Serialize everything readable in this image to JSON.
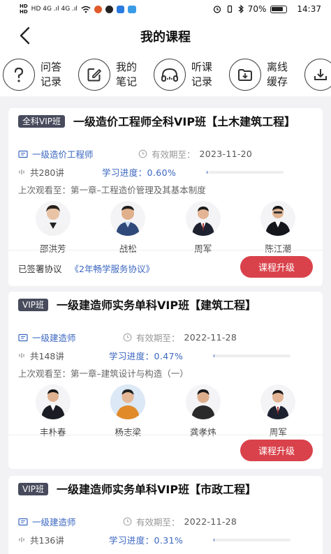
{
  "status_bar": {
    "carrier_left": "HD 4G .ıl 4G .ıl",
    "battery_pct": "70%",
    "time": "14:37"
  },
  "header": {
    "title": "我的课程"
  },
  "tools": [
    {
      "label": "问答\n记录",
      "icon": "question-icon"
    },
    {
      "label": "我的\n笔记",
      "icon": "note-icon"
    },
    {
      "label": "听课\n记录",
      "icon": "headphones-icon"
    },
    {
      "label": "离线\n缓存",
      "icon": "download-icon"
    }
  ],
  "labels": {
    "validity": "有效期至：",
    "progress": "学习进度：",
    "last_watch": "上次观看至：",
    "signed": "已签署协议",
    "upgrade": "课程升级"
  },
  "courses": [
    {
      "badge": "全科VIP班",
      "title": "一级造价工程师全科VIP班【土木建筑工程】",
      "category": "一级造价工程师",
      "expiry": "2023-11-20",
      "lessons": "共280讲",
      "progress": "0.60%",
      "progress_value": 0.006,
      "last_watch": "第一章–工程造价管理及其基本制度",
      "teachers": [
        "邵洪芳",
        "战松",
        "周军",
        "陈江潮"
      ],
      "agreement": "《2年畅学服务协议》"
    },
    {
      "badge": "VIP班",
      "title": "一级建造师实务单科VIP班【建筑工程】",
      "category": "一级建造师",
      "expiry": "2022-11-28",
      "lessons": "共148讲",
      "progress": "0.47%",
      "progress_value": 0.0047,
      "last_watch": "第一章–建筑设计与构造（一）",
      "teachers": [
        "丰朴春",
        "杨志梁",
        "龚孝炜",
        "周军"
      ]
    },
    {
      "badge": "VIP班",
      "title": "一级建造师实务单科VIP班【市政工程】",
      "category": "一级建造师",
      "expiry": "2022-11-28",
      "lessons": "共136讲",
      "progress": "0.31%",
      "progress_value": 0.0031
    }
  ]
}
